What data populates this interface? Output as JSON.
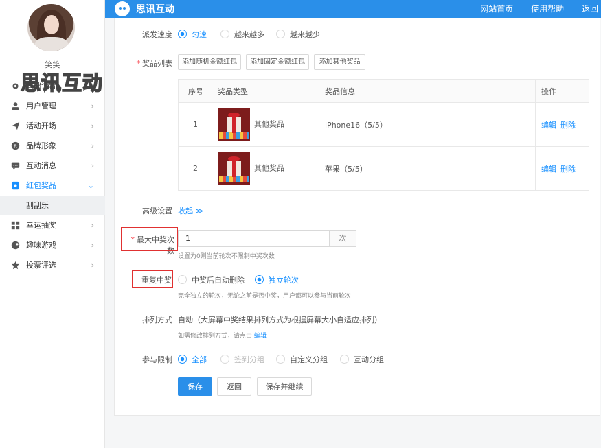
{
  "user": {
    "name": "笑笑"
  },
  "watermark": "思讯互动",
  "sidebar": {
    "items": [
      {
        "label": "基础设置",
        "icon": "gear-icon"
      },
      {
        "label": "用户管理",
        "icon": "user-icon"
      },
      {
        "label": "活动开场",
        "icon": "send-icon"
      },
      {
        "label": "品牌形象",
        "icon": "registered-icon"
      },
      {
        "label": "互动消息",
        "icon": "message-icon"
      },
      {
        "label": "红包奖品",
        "icon": "redpacket-icon"
      },
      {
        "label": "刮刮乐",
        "icon": ""
      },
      {
        "label": "幸运抽奖",
        "icon": "lottery-icon"
      },
      {
        "label": "趣味游戏",
        "icon": "game-icon"
      },
      {
        "label": "投票评选",
        "icon": "star-icon"
      }
    ]
  },
  "topbar": {
    "brand": "思讯互动",
    "links": [
      "网站首页",
      "使用帮助",
      "返回"
    ]
  },
  "form": {
    "speed": {
      "label": "派发速度",
      "options": [
        "匀速",
        "越来越多",
        "越来越少"
      ],
      "selected": "匀速"
    },
    "prize_list": {
      "label": "奖品列表",
      "buttons": [
        "添加随机金额红包",
        "添加固定金额红包",
        "添加其他奖品"
      ],
      "columns": [
        "序号",
        "奖品类型",
        "奖品信息",
        "操作"
      ],
      "rows": [
        {
          "index": "1",
          "type": "其他奖品",
          "info": "iPhone16（5/5）",
          "edit": "编辑",
          "delete": "删除"
        },
        {
          "index": "2",
          "type": "其他奖品",
          "info": "苹果（5/5）",
          "edit": "编辑",
          "delete": "删除"
        }
      ]
    },
    "advanced": {
      "label": "高级设置",
      "toggle": "收起"
    },
    "max_wins": {
      "label": "最大中奖次数",
      "value": "1",
      "unit": "次",
      "hint": "设置为0则当前轮次不限制中奖次数"
    },
    "repeat": {
      "label": "重复中奖",
      "options": [
        "中奖后自动删除",
        "独立轮次"
      ],
      "selected": "独立轮次",
      "hint": "完全独立的轮次，无论之前是否中奖，用户都可以参与当前轮次"
    },
    "sort": {
      "label": "排列方式",
      "value": "自动（大屏幕中奖结果排列方式为根据屏幕大小自适应排列）",
      "hint": "如需修改排列方式，请点击",
      "hint_link": "编辑"
    },
    "limit": {
      "label": "参与限制",
      "options": [
        "全部",
        "签到分组",
        "自定义分组",
        "互动分组"
      ],
      "selected": "全部"
    },
    "actions": {
      "save": "保存",
      "back": "返回",
      "save_continue": "保存并继续"
    }
  }
}
